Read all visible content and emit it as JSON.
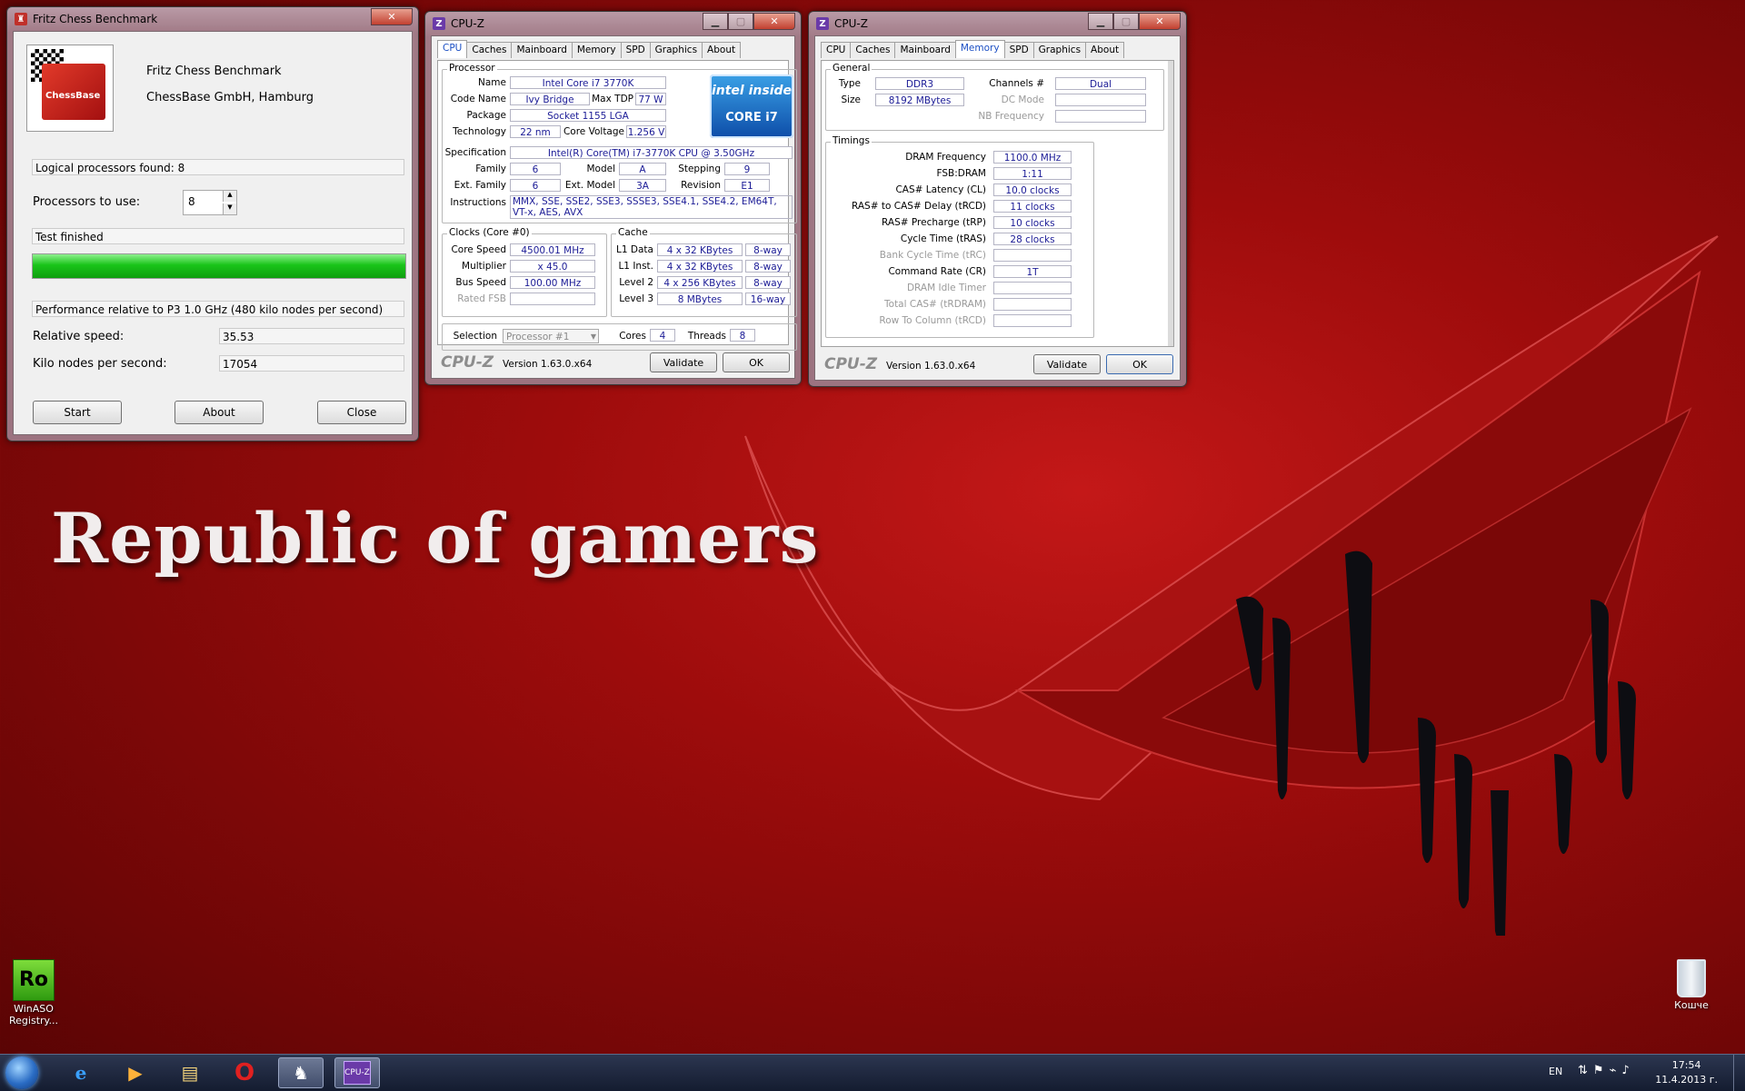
{
  "wallpaper": {
    "title": "Republic of gamers"
  },
  "fritz": {
    "title": "Fritz Chess Benchmark",
    "app_name": "Fritz Chess Benchmark",
    "company": "ChessBase GmbH, Hamburg",
    "logo_text": "ChessBase",
    "logical_processors": "Logical processors found: 8",
    "processors_label": "Processors to use:",
    "processors_value": "8",
    "status": "Test finished",
    "progress": 1.0,
    "perf_text": "Performance relative to P3 1.0 GHz (480 kilo nodes per second)",
    "relative_label": "Relative speed:",
    "relative_value": "35.53",
    "knps_label": "Kilo nodes per second:",
    "knps_value": "17054",
    "btn_start": "Start",
    "btn_about": "About",
    "btn_close": "Close"
  },
  "cpuz_cpu": {
    "title": "CPU-Z",
    "tabs": [
      "CPU",
      "Caches",
      "Mainboard",
      "Memory",
      "SPD",
      "Graphics",
      "About"
    ],
    "processor_group": "Processor",
    "name_label": "Name",
    "name": "Intel Core i7 3770K",
    "codename_label": "Code Name",
    "codename": "Ivy Bridge",
    "maxtdp_label": "Max TDP",
    "maxtdp": "77 W",
    "package_label": "Package",
    "package": "Socket 1155 LGA",
    "tech_label": "Technology",
    "tech": "22 nm",
    "voltage_label": "Core Voltage",
    "voltage": "1.256 V",
    "spec_label": "Specification",
    "spec": "Intel(R) Core(TM) i7-3770K CPU @ 3.50GHz",
    "family_label": "Family",
    "family": "6",
    "model_label": "Model",
    "model": "A",
    "stepping_label": "Stepping",
    "stepping": "9",
    "extfamily_label": "Ext. Family",
    "extfamily": "6",
    "extmodel_label": "Ext. Model",
    "extmodel": "3A",
    "revision_label": "Revision",
    "revision": "E1",
    "instr_label": "Instructions",
    "instr1": "MMX, SSE, SSE2, SSE3, SSSE3, SSE4.1, SSE4.2, EM64T,",
    "instr2": "VT-x, AES, AVX",
    "badge_inside": "intel inside",
    "badge_core": "CORE i7",
    "clocks_group": "Clocks (Core #0)",
    "corespeed_label": "Core Speed",
    "corespeed": "4500.01 MHz",
    "multiplier_label": "Multiplier",
    "multiplier": "x 45.0",
    "busspeed_label": "Bus Speed",
    "busspeed": "100.00 MHz",
    "ratedfsb_label": "Rated FSB",
    "ratedfsb": "",
    "cache_group": "Cache",
    "l1d_label": "L1 Data",
    "l1d": "4 x 32 KBytes",
    "l1d_way": "8-way",
    "l1i_label": "L1 Inst.",
    "l1i": "4 x 32 KBytes",
    "l1i_way": "8-way",
    "l2_label": "Level 2",
    "l2": "4 x 256 KBytes",
    "l2_way": "8-way",
    "l3_label": "Level 3",
    "l3": "8 MBytes",
    "l3_way": "16-way",
    "selection_label": "Selection",
    "selection": "Processor #1",
    "cores_label": "Cores",
    "cores": "4",
    "threads_label": "Threads",
    "threads": "8",
    "footer_logo": "CPU-Z",
    "version": "Version 1.63.0.x64",
    "btn_validate": "Validate",
    "btn_ok": "OK"
  },
  "cpuz_mem": {
    "title": "CPU-Z",
    "tabs": [
      "CPU",
      "Caches",
      "Mainboard",
      "Memory",
      "SPD",
      "Graphics",
      "About"
    ],
    "general_group": "General",
    "type_label": "Type",
    "type": "DDR3",
    "size_label": "Size",
    "size": "8192 MBytes",
    "channels_label": "Channels #",
    "channels": "Dual",
    "dcmode_label": "DC Mode",
    "nbfreq_label": "NB Frequency",
    "timings_group": "Timings",
    "dramfreq_label": "DRAM Frequency",
    "dramfreq": "1100.0 MHz",
    "fsbdram_label": "FSB:DRAM",
    "fsbdram": "1:11",
    "cas_label": "CAS# Latency (CL)",
    "cas": "10.0 clocks",
    "trcd_label": "RAS# to CAS# Delay (tRCD)",
    "trcd": "11 clocks",
    "trp_label": "RAS# Precharge (tRP)",
    "trp": "10 clocks",
    "tras_label": "Cycle Time (tRAS)",
    "tras": "28 clocks",
    "trc_label": "Bank Cycle Time (tRC)",
    "cr_label": "Command Rate (CR)",
    "cr": "1T",
    "idle_label": "DRAM Idle Timer",
    "trdram_label": "Total CAS# (tRDRAM)",
    "trcd2_label": "Row To Column (tRCD)",
    "footer_logo": "CPU-Z",
    "version": "Version 1.63.0.x64",
    "btn_validate": "Validate",
    "btn_ok": "OK"
  },
  "desktop": {
    "winaso_label1": "WinASO",
    "winaso_label2": "Registry...",
    "winaso_badge": "Ro",
    "recycle_label": "Кошче"
  },
  "taskbar": {
    "lang": "EN",
    "time": "17:54",
    "date": "11.4.2013 г."
  },
  "colors": {
    "accent": "#1b4fc4",
    "progress": "#19c419",
    "value_text": "#1b1b96"
  }
}
